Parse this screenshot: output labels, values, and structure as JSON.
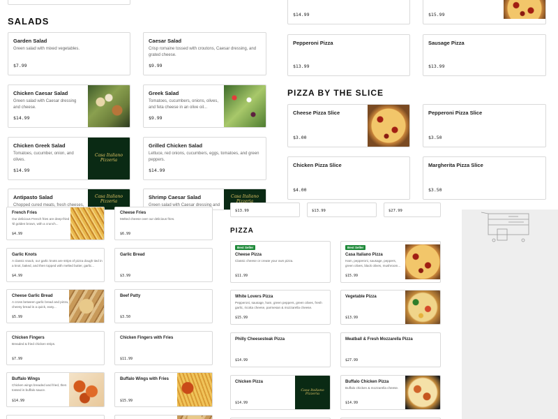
{
  "top": {
    "salads_title": "SALADS",
    "slice_title": "PIZZA BY THE SLICE",
    "cards": [
      {
        "name": "",
        "desc": "",
        "price": "$14.99"
      },
      {
        "name": "",
        "desc": "",
        "price": "$15.99"
      },
      {
        "name": "Garden Salad",
        "desc": "Green salad with mixed vegetables.",
        "price": "$7.99"
      },
      {
        "name": "Caesar Salad",
        "desc": "Crisp romaine tossed with croutons, Caesar dressing, and grated cheese.",
        "price": "$9.99"
      },
      {
        "name": "Pepperoni Pizza",
        "desc": "",
        "price": "$13.99"
      },
      {
        "name": "Sausage Pizza",
        "desc": "",
        "price": "$13.99"
      },
      {
        "name": "Chicken Caesar Salad",
        "desc": "Green salad with Caesar dressing and cheese.",
        "price": "$14.99"
      },
      {
        "name": "Greek Salad",
        "desc": "Tomatoes, cucumbers, onions, olives, and feta cheese in an olive oil...",
        "price": "$9.99"
      },
      {
        "name": "Cheese Pizza Slice",
        "desc": "",
        "price": "$3.00"
      },
      {
        "name": "Pepperoni Pizza Slice",
        "desc": "",
        "price": "$3.50"
      },
      {
        "name": "Chicken Greek Salad",
        "desc": "Tomatoes, cucumber, onion, and olives.",
        "price": "$14.99"
      },
      {
        "name": "Grilled Chicken Salad",
        "desc": "Lettuce, red onions, cucumbers, eggs, tomatoes, and green peppers.",
        "price": "$14.99"
      },
      {
        "name": "Chicken Pizza Slice",
        "desc": "",
        "price": "$4.00"
      },
      {
        "name": "Margherita Pizza Slice",
        "desc": "",
        "price": "$3.50"
      },
      {
        "name": "Antipasto Salad",
        "desc": "Chopped cured meats, fresh cheeses,",
        "price": ""
      },
      {
        "name": "Shrimp Caesar Salad",
        "desc": "Green salad with Caesar dressing and",
        "price": ""
      }
    ],
    "logo_text": "Casa Italiano Pizzeria"
  },
  "bottom": {
    "pizza_title": "PIZZA",
    "best_seller": "Best Seller",
    "stub_prices": [
      "$13.99",
      "$13.99",
      "$27.99"
    ],
    "cards": [
      {
        "name": "French Fries",
        "desc": "Our delicious French fries are deep-fried 'til golden brown, with a crunch...",
        "price": "$4.99"
      },
      {
        "name": "Cheese Fries",
        "desc": "Melted cheese over our delicious fries.",
        "price": "$6.99"
      },
      {
        "name": "Cheese Pizza",
        "desc": "Classic cheese or create your own pizza.",
        "price": "$11.99"
      },
      {
        "name": "Casa Italiano Pizza",
        "desc": "Ham, pepperoni, sausage, peppers, green olives, black olives, mushroom...",
        "price": "$15.99"
      },
      {
        "name": "Garlic Knots",
        "desc": "A classic snack, our garlic knots are strips of pizza dough tied in a knot, baked, and then topped with melted butter, garlic...",
        "price": "$4.99"
      },
      {
        "name": "Garlic Bread",
        "desc": "",
        "price": "$3.99"
      },
      {
        "name": "White Lovers Pizza",
        "desc": "Pepperoni, sausage, ham, green peppers, green olives, fresh garlic, ricotta cheese, parmesan & mozzarella cheese.",
        "price": "$15.99"
      },
      {
        "name": "Vegetable Pizza",
        "desc": "",
        "price": "$13.99"
      },
      {
        "name": "Cheese Garlic Bread",
        "desc": "A cross between garlic bread and pizza, cheesy bread is a quick, easy...",
        "price": "$5.99"
      },
      {
        "name": "Beef Patty",
        "desc": "",
        "price": "$3.50"
      },
      {
        "name": "Philly Cheesesteak Pizza",
        "desc": "",
        "price": "$14.99"
      },
      {
        "name": "Meatball & Fresh Mozzarella Pizza",
        "desc": "",
        "price": "$27.99"
      },
      {
        "name": "Chicken Fingers",
        "desc": "Breaded & fried chicken strips.",
        "price": "$7.99"
      },
      {
        "name": "Chicken Fingers with Fries",
        "desc": "",
        "price": "$11.99"
      },
      {
        "name": "Chicken Pizza",
        "desc": "",
        "price": "$14.99"
      },
      {
        "name": "Buffalo Chicken Pizza",
        "desc": "Buffalo chicken & mozzarella cheese.",
        "price": "$14.99"
      },
      {
        "name": "Buffalo Wings",
        "desc": "Chicken wings breaded and fried, then tossed in buffalo sauce.",
        "price": "$14.99"
      },
      {
        "name": "Buffalo Wings with Fries",
        "desc": "",
        "price": "$15.99"
      }
    ]
  },
  "colors": {
    "accent": "#1f8a3a",
    "border": "#d9d9d9",
    "text": "#222222",
    "muted": "#666666"
  }
}
